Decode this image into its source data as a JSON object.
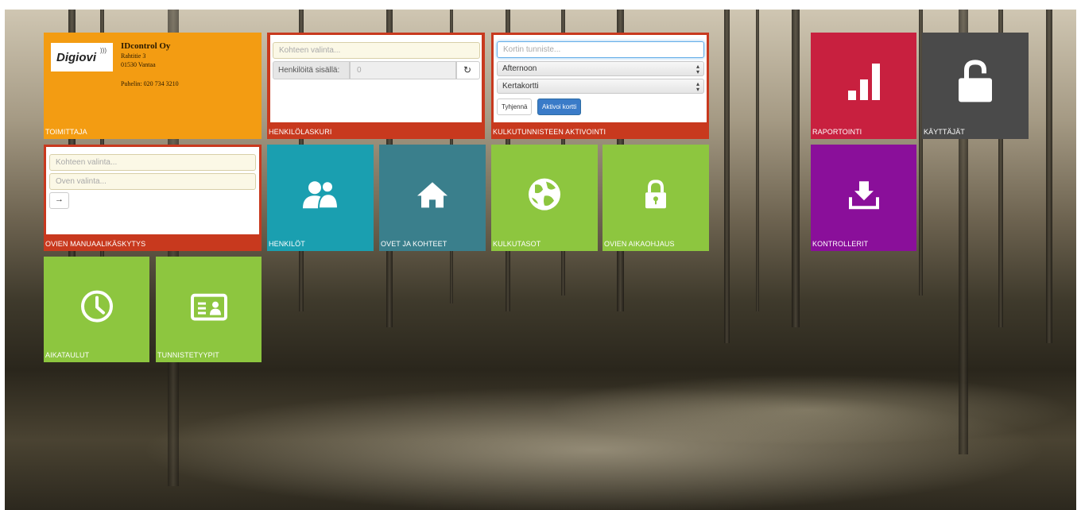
{
  "tiles": {
    "toimittaja": {
      "title": "TOIMITTAJA",
      "logo_text": "Digiovi",
      "company": "IDcontrol Oy",
      "street": "Rahtitie 3",
      "city": "01530 Vantaa",
      "phone": "Puhelin: 020 734 3210",
      "color": "#f39c12"
    },
    "henkilolaskuri": {
      "title": "HENKILÖLASKURI",
      "target_placeholder": "Kohteen valinta...",
      "inside_label": "Henkilöitä sisällä:",
      "inside_value": "0",
      "refresh_icon": "refresh-icon"
    },
    "aktivointi": {
      "title": "KULKUTUNNISTEEN AKTIVOINTI",
      "card_placeholder": "Kortin tunniste...",
      "level_select": "Afternoon",
      "type_select": "Kertakortti",
      "clear_label": "Tyhjennä",
      "activate_label": "Aktivoi kortti"
    },
    "manuaali": {
      "title": "OVIEN MANUAALIKÄSKYTYS",
      "target_placeholder": "Kohteen valinta...",
      "door_placeholder": "Oven valinta...",
      "enter_icon": "sign-in-icon"
    },
    "henkilot": {
      "title": "HENKILÖT",
      "icon": "users-icon",
      "color": "#1a9fb0"
    },
    "ovet": {
      "title": "OVET JA KOHTEET",
      "icon": "home-icon",
      "color": "#3a7f8c"
    },
    "kulkutasot": {
      "title": "KULKUTASOT",
      "icon": "globe-icon",
      "color": "#8dc63f"
    },
    "aikaohjaus": {
      "title": "OVIEN AIKAOHJAUS",
      "icon": "lock-icon",
      "color": "#8dc63f"
    },
    "aikataulut": {
      "title": "AIKATAULUT",
      "icon": "clock-icon",
      "color": "#8dc63f"
    },
    "tunnistetyypit": {
      "title": "TUNNISTETYYPIT",
      "icon": "id-card-icon",
      "color": "#8dc63f"
    },
    "raportointi": {
      "title": "RAPORTOINTI",
      "icon": "bar-chart-icon",
      "color": "#c8203f"
    },
    "kayttajat": {
      "title": "KÄYTTÄJÄT",
      "icon": "unlock-icon",
      "color": "#4a4a4a"
    },
    "kontrollerit": {
      "title": "KONTROLLERIT",
      "icon": "inbox-icon",
      "color": "#8a0f9a"
    }
  }
}
